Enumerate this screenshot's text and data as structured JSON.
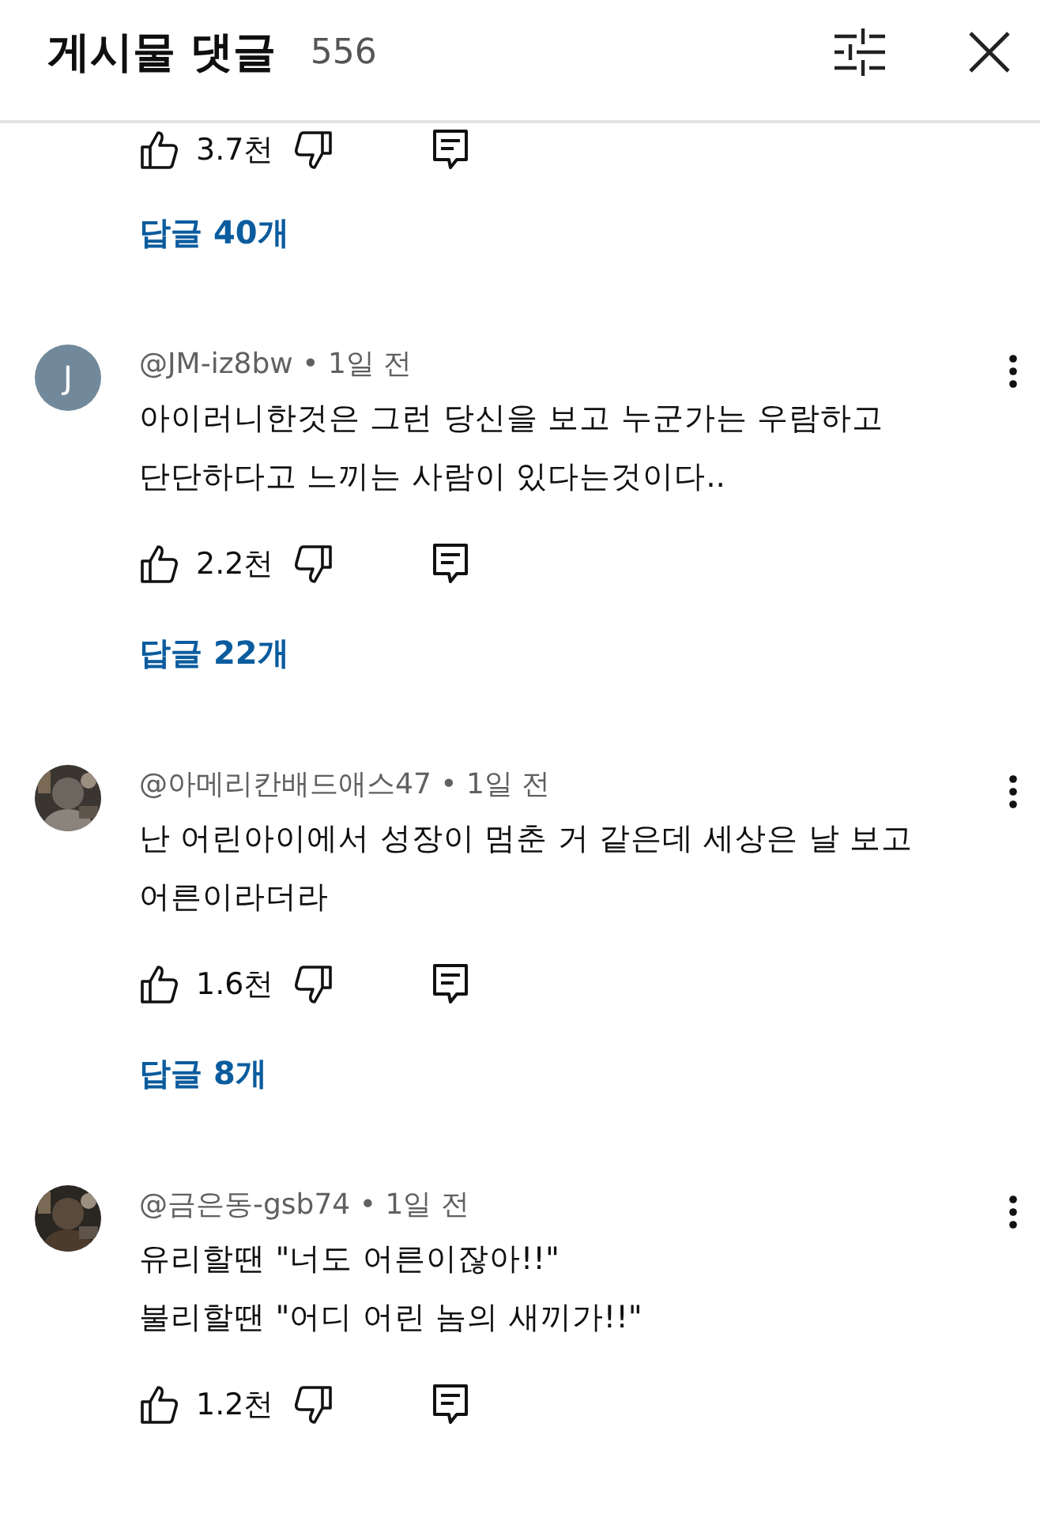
{
  "header": {
    "title": "게시물 댓글",
    "count": "556"
  },
  "top_actions": {
    "likes": "3.7천",
    "replies_link": "답글 40개"
  },
  "comments": [
    {
      "avatar": {
        "kind": "letter",
        "letter": "J"
      },
      "meta": "@JM-iz8bw • 1일 전",
      "lines": [
        "아이러니한것은 그런 당신을 보고 누군가는 우람하고",
        "단단하다고 느끼는 사람이 있다는것이다.."
      ],
      "likes": "2.2천",
      "replies_link": "답글 22개"
    },
    {
      "avatar": {
        "kind": "picture"
      },
      "meta": "@아메리칸배드애스47 • 1일 전",
      "lines": [
        "난 어린아이에서 성장이 멈춘 거 같은데 세상은 날 보고",
        "어른이라더라"
      ],
      "likes": "1.6천",
      "replies_link": "답글 8개"
    },
    {
      "avatar": {
        "kind": "picture"
      },
      "meta": "@금은동-gsb74 • 1일 전",
      "lines": [
        "유리할땐 \"너도 어른이잖아!!\"",
        "불리할땐 \"어디 어린 놈의 새끼가!!\""
      ],
      "likes": "1.2천"
    }
  ]
}
